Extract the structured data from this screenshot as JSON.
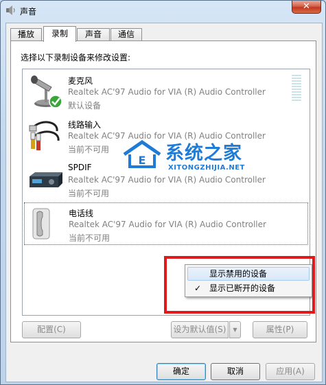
{
  "window": {
    "title": "声音",
    "close_label": "✕"
  },
  "tabs": [
    {
      "label": "播放"
    },
    {
      "label": "录制",
      "active": true
    },
    {
      "label": "声音"
    },
    {
      "label": "通信"
    }
  ],
  "prompt": "选择以下录制设备来修改设置:",
  "devices": [
    {
      "name": "麦克风",
      "driver": "Realtek AC'97 Audio for VIA (R) Audio Controller",
      "status": "默认设备",
      "icon": "microphone-icon"
    },
    {
      "name": "线路输入",
      "driver": "Realtek AC'97 Audio for VIA (R) Audio Controller",
      "status": "当前不可用",
      "icon": "line-in-cable-icon"
    },
    {
      "name": "SPDIF",
      "driver": "Realtek AC'97 Audio for VIA (R) Audio Controller",
      "status": "当前不可用",
      "icon": "spdif-device-icon"
    },
    {
      "name": "电话线",
      "driver": "Realtek AC'97 Audio for VIA (R) Audio Controller",
      "status": "当前不可用",
      "icon": "telephone-handset-icon"
    }
  ],
  "buttons": {
    "configure": "配置(C)",
    "set_default": "设为默认值(S)",
    "properties": "属性(P)",
    "ok": "确定",
    "cancel": "取消",
    "apply": "应用(A)"
  },
  "context_menu": {
    "items": [
      {
        "label": "显示禁用的设备",
        "checked": false
      },
      {
        "label": "显示已断开的设备",
        "checked": true
      }
    ],
    "check_mark": "✓"
  },
  "watermark": {
    "title": "系统之家",
    "url": "XITONGZHIJIA.NET"
  },
  "colors": {
    "highlight": "#e0191c",
    "watermark": "#1f7bd6"
  }
}
